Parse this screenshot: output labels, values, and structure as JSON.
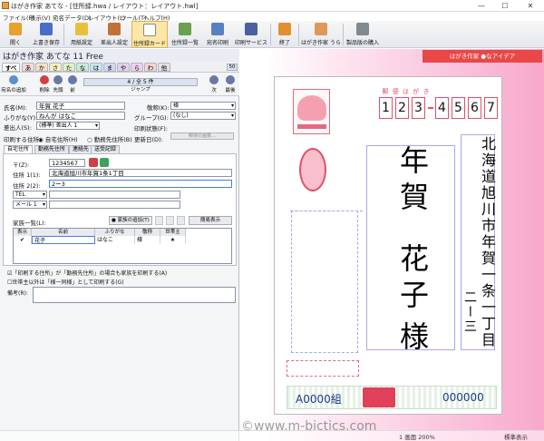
{
  "window": {
    "title": "はがき作家 あてな - [住所録.hwa / レイアウト：レイアウト.hwl]",
    "minimize": "—",
    "maximize": "☐",
    "close": "✕"
  },
  "menu": [
    "ファイル(F)",
    "表示(V)",
    "宛名データ(D)",
    "レイアウト(L)",
    "ツール(T)",
    "ヘルプ(H)"
  ],
  "toolbar": [
    {
      "label": "開く",
      "icon": "open-folder-icon",
      "color": "#e8a030"
    },
    {
      "label": "上書き保存",
      "icon": "save-icon",
      "color": "#4a6ec8"
    },
    {
      "label": "用紙設定",
      "icon": "paper-setup-icon",
      "color": "#e8c040"
    },
    {
      "label": "差出人設定",
      "icon": "sender-setup-icon",
      "color": "#c07038"
    },
    {
      "label": "住所録カード",
      "icon": "address-card-icon",
      "color": "#d0d4da"
    },
    {
      "label": "住所録一覧",
      "icon": "address-list-icon",
      "color": "#6aa050"
    },
    {
      "label": "宛名印刷",
      "icon": "print-address-icon",
      "color": "#5a80c0"
    },
    {
      "label": "印刷サービス",
      "icon": "print-service-icon",
      "color": "#4a60a0"
    },
    {
      "label": "終了",
      "icon": "exit-icon",
      "color": "#e09030"
    },
    {
      "label": "はがき作家 うら",
      "icon": "hagaki-ura-icon",
      "color": "#e09858"
    },
    {
      "label": "製品版の購入",
      "icon": "cart-icon",
      "color": "#808890"
    }
  ],
  "app": {
    "header": "はがき作家 あてな 11 Free",
    "ad": "はがき作家 ●なアイデア"
  },
  "kana_tabs": [
    "すべて",
    "あ",
    "か",
    "さ",
    "た",
    "な",
    "は",
    "ま",
    "や",
    "ら",
    "わ",
    "他"
  ],
  "count_badge": "50",
  "nav": {
    "new": "宛名の追加",
    "delete": "削除",
    "first": "先頭",
    "prev": "前",
    "page": "4 / 全 5 件",
    "jump": "ジャンプ",
    "next": "次",
    "last": "最後"
  },
  "form": {
    "name_label": "氏名(M):",
    "name_value": "年賀 花子",
    "honorific_label": "敬称(K):",
    "honorific_value": "様",
    "furigana_label": "ふりがな(Y):",
    "furigana_value": "ねんが はなこ",
    "group_label": "グループ(G):",
    "group_value": "(なし)",
    "sender_label": "差出人(S):",
    "sender_value": "(標準) 差出人 1",
    "print_status_label": "印刷状態(F):",
    "print_addr_label": "印刷する住所:",
    "radio_home": "自宅住所(H)",
    "radio_work": "勤務先住所(B)",
    "updated_label": "更新日(D):"
  },
  "stamp_box": {
    "button": "郵便の画像…"
  },
  "tabs": [
    "自宅住所",
    "勤務先住所",
    "連絡先",
    "送受記録"
  ],
  "address": {
    "zip_label": "〒(Z):",
    "zip_value": "1234567",
    "addr1_label": "住所 1(1):",
    "addr1_value": "北海道旭川市年賀1条1丁目",
    "addr2_label": "住所 2(2):",
    "addr2_value": "2ー3",
    "tel_label": "TEL",
    "mail_label": "メール 1"
  },
  "family": {
    "label": "家族一覧(L):",
    "add_button": "家族の追加(T)",
    "simple_button": "簡易表示",
    "columns": [
      "表示",
      "名前",
      "ふりがな",
      "敬称",
      "世帯主"
    ],
    "rows": [
      {
        "show": "✔",
        "name": "花子",
        "kana": "はなこ",
        "title": "様",
        "head": "★"
      }
    ]
  },
  "options": {
    "opt1": "「印刷する住所」が「勤務先住所」の場合も家族を印刷する(A)",
    "opt2": "世帯主以外は「様一同様」として印刷する(G)",
    "memo_label": "備考(R):"
  },
  "card": {
    "header": "郵 便 は が き",
    "zip": [
      "1",
      "2",
      "3",
      "4",
      "5",
      "6",
      "7"
    ],
    "address_line1": "北海道旭川市年賀一条一丁目",
    "address_line2": "二ー三",
    "name": "年賀",
    "given": "花子",
    "honorific": "様",
    "lottery_left": "A0000組",
    "lottery_right": "000000"
  },
  "status": {
    "copyright": "©www.m-bictics.com",
    "page": "1 画面 200%",
    "reset": "標準表示"
  }
}
